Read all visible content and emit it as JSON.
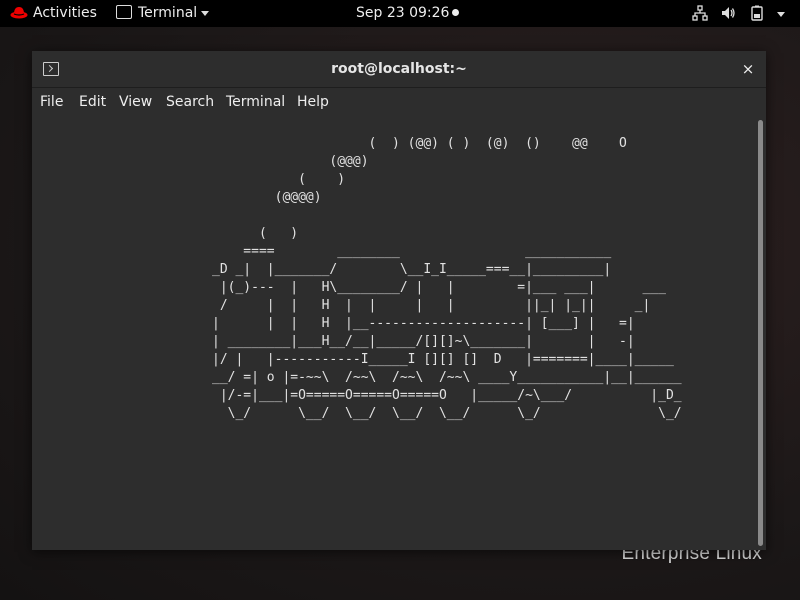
{
  "topbar": {
    "activities": "Activities",
    "app_menu": "Terminal",
    "clock": "Sep 23  09:26"
  },
  "brand": "Enterprise Linux",
  "window": {
    "title": "root@localhost:~",
    "close_glyph": "×",
    "menus": [
      "File",
      "Edit",
      "View",
      "Search",
      "Terminal",
      "Help"
    ]
  },
  "terminal": {
    "lines": [
      "                    (  ) (@@) ( )  (@)  ()    @@    O",
      "               (@@@)",
      "           (    )",
      "        (@@@@)",
      "",
      "      (   )",
      "    ====        ________                ___________",
      "_D _|  |_______/        \\__I_I_____===__|_________|",
      " |(_)---  |   H\\________/ |   |        =|___ ___|      ___",
      " /     |  |   H  |  |     |   |         ||_| |_||     _|",
      "|      |  |   H  |__--------------------| [___] |   =|",
      "| ________|___H__/__|_____/[][]~\\_______|       |   -|",
      "|/ |   |-----------I_____I [][] []  D   |=======|____|_____",
      "__/ =| o |=-~~\\  /~~\\  /~~\\  /~~\\ ____Y___________|__|______",
      " |/-=|___|=O=====O=====O=====O   |_____/~\\___/          |_D_",
      "  \\_/      \\__/  \\__/  \\__/  \\__/      \\_/               \\_/"
    ]
  }
}
